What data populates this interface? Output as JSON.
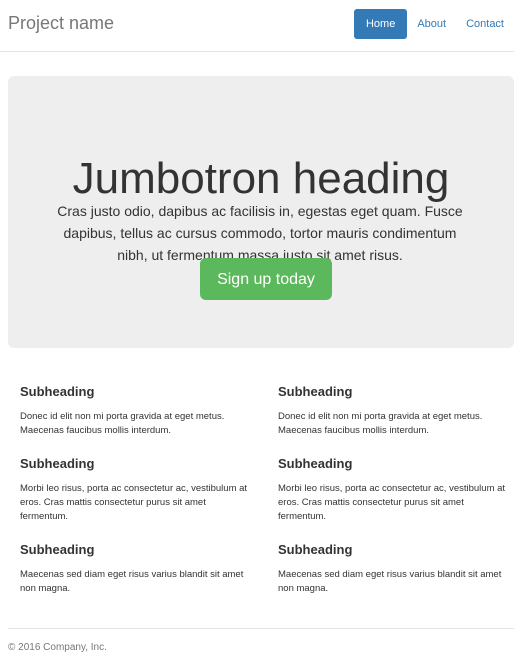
{
  "brand": "Project name",
  "nav": [
    {
      "label": "Home",
      "active": true
    },
    {
      "label": "About",
      "active": false
    },
    {
      "label": "Contact",
      "active": false
    }
  ],
  "jumbotron": {
    "heading": "Jumbotron heading",
    "text": "Cras justo odio, dapibus ac facilisis in, egestas eget quam. Fusce dapibus, tellus ac cursus commodo, tortor mauris condimentum nibh, ut fermentum massa justo sit amet risus.",
    "button_label": "Sign up today"
  },
  "features": [
    {
      "heading": "Subheading",
      "text": "Donec id elit non mi porta gravida at eget metus. Maecenas faucibus mollis interdum."
    },
    {
      "heading": "Subheading",
      "text": "Morbi leo risus, porta ac consectetur ac, vestibulum at eros. Cras mattis consectetur purus sit amet fermentum."
    },
    {
      "heading": "Subheading",
      "text": "Maecenas sed diam eget risus varius blandit sit amet non magna."
    },
    {
      "heading": "Subheading",
      "text": "Donec id elit non mi porta gravida at eget metus. Maecenas faucibus mollis interdum."
    },
    {
      "heading": "Subheading",
      "text": "Morbi leo risus, porta ac consectetur ac, vestibulum at eros. Cras mattis consectetur purus sit amet fermentum."
    },
    {
      "heading": "Subheading",
      "text": "Maecenas sed diam eget risus varius blandit sit amet non magna."
    }
  ],
  "footer": "© 2016 Company, Inc.",
  "colors": {
    "primary": "#337ab7",
    "success": "#5cb85c",
    "jumbotron_bg": "#eeeeee",
    "muted": "#777777"
  }
}
